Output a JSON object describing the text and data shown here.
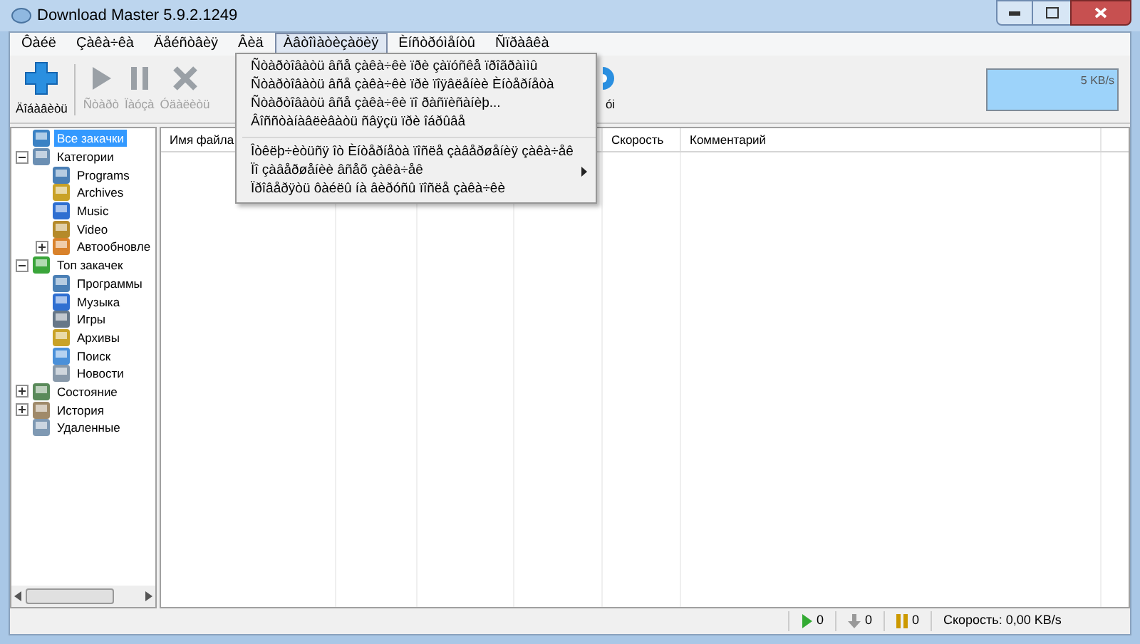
{
  "window": {
    "title": "Download Master 5.9.2.1249"
  },
  "menu_bar": [
    {
      "label": "Ôàéë",
      "selected": false
    },
    {
      "label": "Çàêà÷êà",
      "selected": false
    },
    {
      "label": "Äåéñòâèÿ",
      "selected": false
    },
    {
      "label": "Âèä",
      "selected": false
    },
    {
      "label": "Àâòîìàòèçàöèÿ",
      "selected": true
    },
    {
      "label": "Èíñòðóìåíòû",
      "selected": false
    },
    {
      "label": "Ñïðàâêà",
      "selected": false
    }
  ],
  "toolbar": [
    {
      "kind": "add",
      "label": "Äîáàâèòü",
      "disabled": false
    },
    {
      "kind": "start",
      "label": "Ñòàðò",
      "disabled": true
    },
    {
      "kind": "pause",
      "label": "Ïàóçà",
      "disabled": true
    },
    {
      "kind": "delete",
      "label": "Óäàëèòü",
      "disabled": true
    },
    {
      "kind": "partial",
      "label": "ói",
      "disabled": false
    }
  ],
  "speed_graph": {
    "label": "5 KB/s"
  },
  "dropdown": {
    "items": [
      {
        "kind": "item",
        "label": "Ñòàðòîâàòü âñå çàêà÷êè ïðè çàïóñêå ïðîãðàììû"
      },
      {
        "kind": "item",
        "label": "Ñòàðòîâàòü âñå çàêà÷êè ïðè ïîÿâëåíèè Èíòåðíåòà"
      },
      {
        "kind": "item",
        "label": "Ñòàðòîâàòü âñå çàêà÷êè ïî ðàñïèñàíèþ..."
      },
      {
        "kind": "item",
        "label": "Âîññòàíàâëèâàòü ñâÿçü ïðè îáðûâå"
      },
      {
        "kind": "separator"
      },
      {
        "kind": "item",
        "label": "Îòêëþ÷èòüñÿ îò Èíòåðíåòà ïîñëå çàâåðøåíèÿ çàêà÷åê"
      },
      {
        "kind": "submenu",
        "label": "Ïî çàâåðøåíèè âñåõ çàêà÷åê"
      },
      {
        "kind": "item",
        "label": "Ïðîâåðÿòü ôàéëû íà âèðóñû ïîñëå çàêà÷êè"
      }
    ]
  },
  "sidebar": {
    "tree": [
      {
        "label": "Все закачки",
        "selected": true
      },
      {
        "label": "Категории",
        "selected": false,
        "expanded": true,
        "children": [
          {
            "label": "Programs",
            "selected": false
          },
          {
            "label": "Archives",
            "selected": false
          },
          {
            "label": "Music",
            "selected": false
          },
          {
            "label": "Video",
            "selected": false
          },
          {
            "label": "Автообновле",
            "selected": false,
            "expanded": false
          }
        ]
      },
      {
        "label": "Топ закачек",
        "selected": false,
        "expanded": true,
        "children": [
          {
            "label": "Программы",
            "selected": false
          },
          {
            "label": "Музыка",
            "selected": false
          },
          {
            "label": "Игры",
            "selected": false
          },
          {
            "label": "Архивы",
            "selected": false
          },
          {
            "label": "Поиск",
            "selected": false
          },
          {
            "label": "Новости",
            "selected": false
          }
        ]
      },
      {
        "label": "Состояние",
        "selected": false,
        "expanded": false
      },
      {
        "label": "История",
        "selected": false,
        "expanded": false
      },
      {
        "label": "Удаленные",
        "selected": false
      }
    ]
  },
  "table": {
    "columns": [
      {
        "label": "Имя файла"
      },
      {
        "label": "Скорость"
      },
      {
        "label": "Комментарий"
      }
    ]
  },
  "status_bar": {
    "active": "0",
    "downloaded": "0",
    "paused": "0",
    "speed": "Скорость: 0,00 KB/s"
  }
}
